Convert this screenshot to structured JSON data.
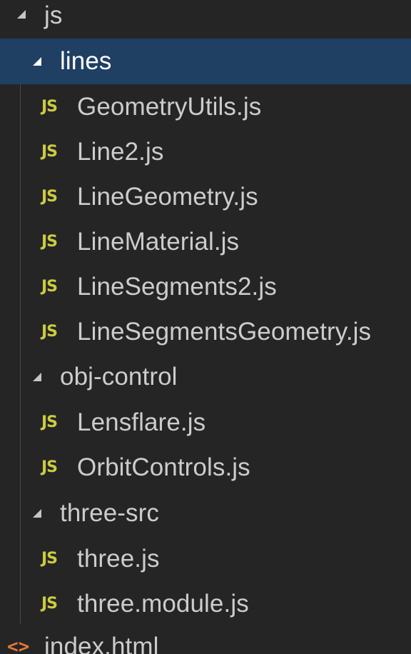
{
  "explorer": {
    "root_folder": {
      "label": "js",
      "expanded": true
    },
    "folders": [
      {
        "label": "lines",
        "expanded": true,
        "selected": true,
        "files": [
          "GeometryUtils.js",
          "Line2.js",
          "LineGeometry.js",
          "LineMaterial.js",
          "LineSegments2.js",
          "LineSegmentsGeometry.js"
        ]
      },
      {
        "label": "obj-control",
        "expanded": true,
        "selected": false,
        "files": [
          "Lensflare.js",
          "OrbitControls.js"
        ]
      },
      {
        "label": "three-src",
        "expanded": true,
        "selected": false,
        "files": [
          "three.js",
          "three.module.js"
        ]
      }
    ],
    "trailing_file": {
      "label": "index.html",
      "icon": "html-icon"
    },
    "js_icon_text": "JS",
    "html_icon_text": "<>",
    "colors": {
      "background": "#252526",
      "selection": "#1f3f63",
      "text": "#cccccc",
      "js_icon": "#cbcb41",
      "html_icon": "#e37933"
    }
  }
}
